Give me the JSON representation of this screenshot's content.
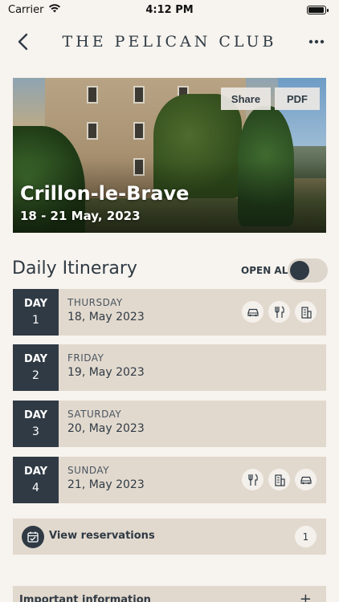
{
  "status_bar": {
    "carrier": "Carrier",
    "time": "4:12 PM",
    "battery_level": 1.0
  },
  "nav": {
    "title": "THE PELICAN CLUB",
    "back_icon": "chevron-left-icon",
    "more_icon": "ellipsis-icon"
  },
  "hero": {
    "title": "Crillon-le-Brave",
    "dates": "18 - 21 May, 2023",
    "share_label": "Share",
    "pdf_label": "PDF"
  },
  "itinerary": {
    "title": "Daily Itinerary",
    "open_all_label": "OPEN ALL",
    "open_all_on": false,
    "days": [
      {
        "day_label": "DAY",
        "day_number": "1",
        "weekday": "THURSDAY",
        "date": "18, May 2023",
        "icons": [
          "car-icon",
          "dining-icon",
          "hotel-icon"
        ]
      },
      {
        "day_label": "DAY",
        "day_number": "2",
        "weekday": "FRIDAY",
        "date": "19, May 2023",
        "icons": []
      },
      {
        "day_label": "DAY",
        "day_number": "3",
        "weekday": "SATURDAY",
        "date": "20, May 2023",
        "icons": []
      },
      {
        "day_label": "DAY",
        "day_number": "4",
        "weekday": "SUNDAY",
        "date": "21, May 2023",
        "icons": [
          "dining-icon",
          "hotel-icon",
          "car-icon"
        ]
      }
    ]
  },
  "reservations": {
    "label": "View reservations",
    "count": "1",
    "icon": "calendar-check-icon"
  },
  "info": {
    "label": "Important information",
    "icon": "plus-icon"
  },
  "colors": {
    "navy": "#2f3a44",
    "row_bg": "#e2d9ce",
    "page_bg": "#f7f3ee"
  }
}
